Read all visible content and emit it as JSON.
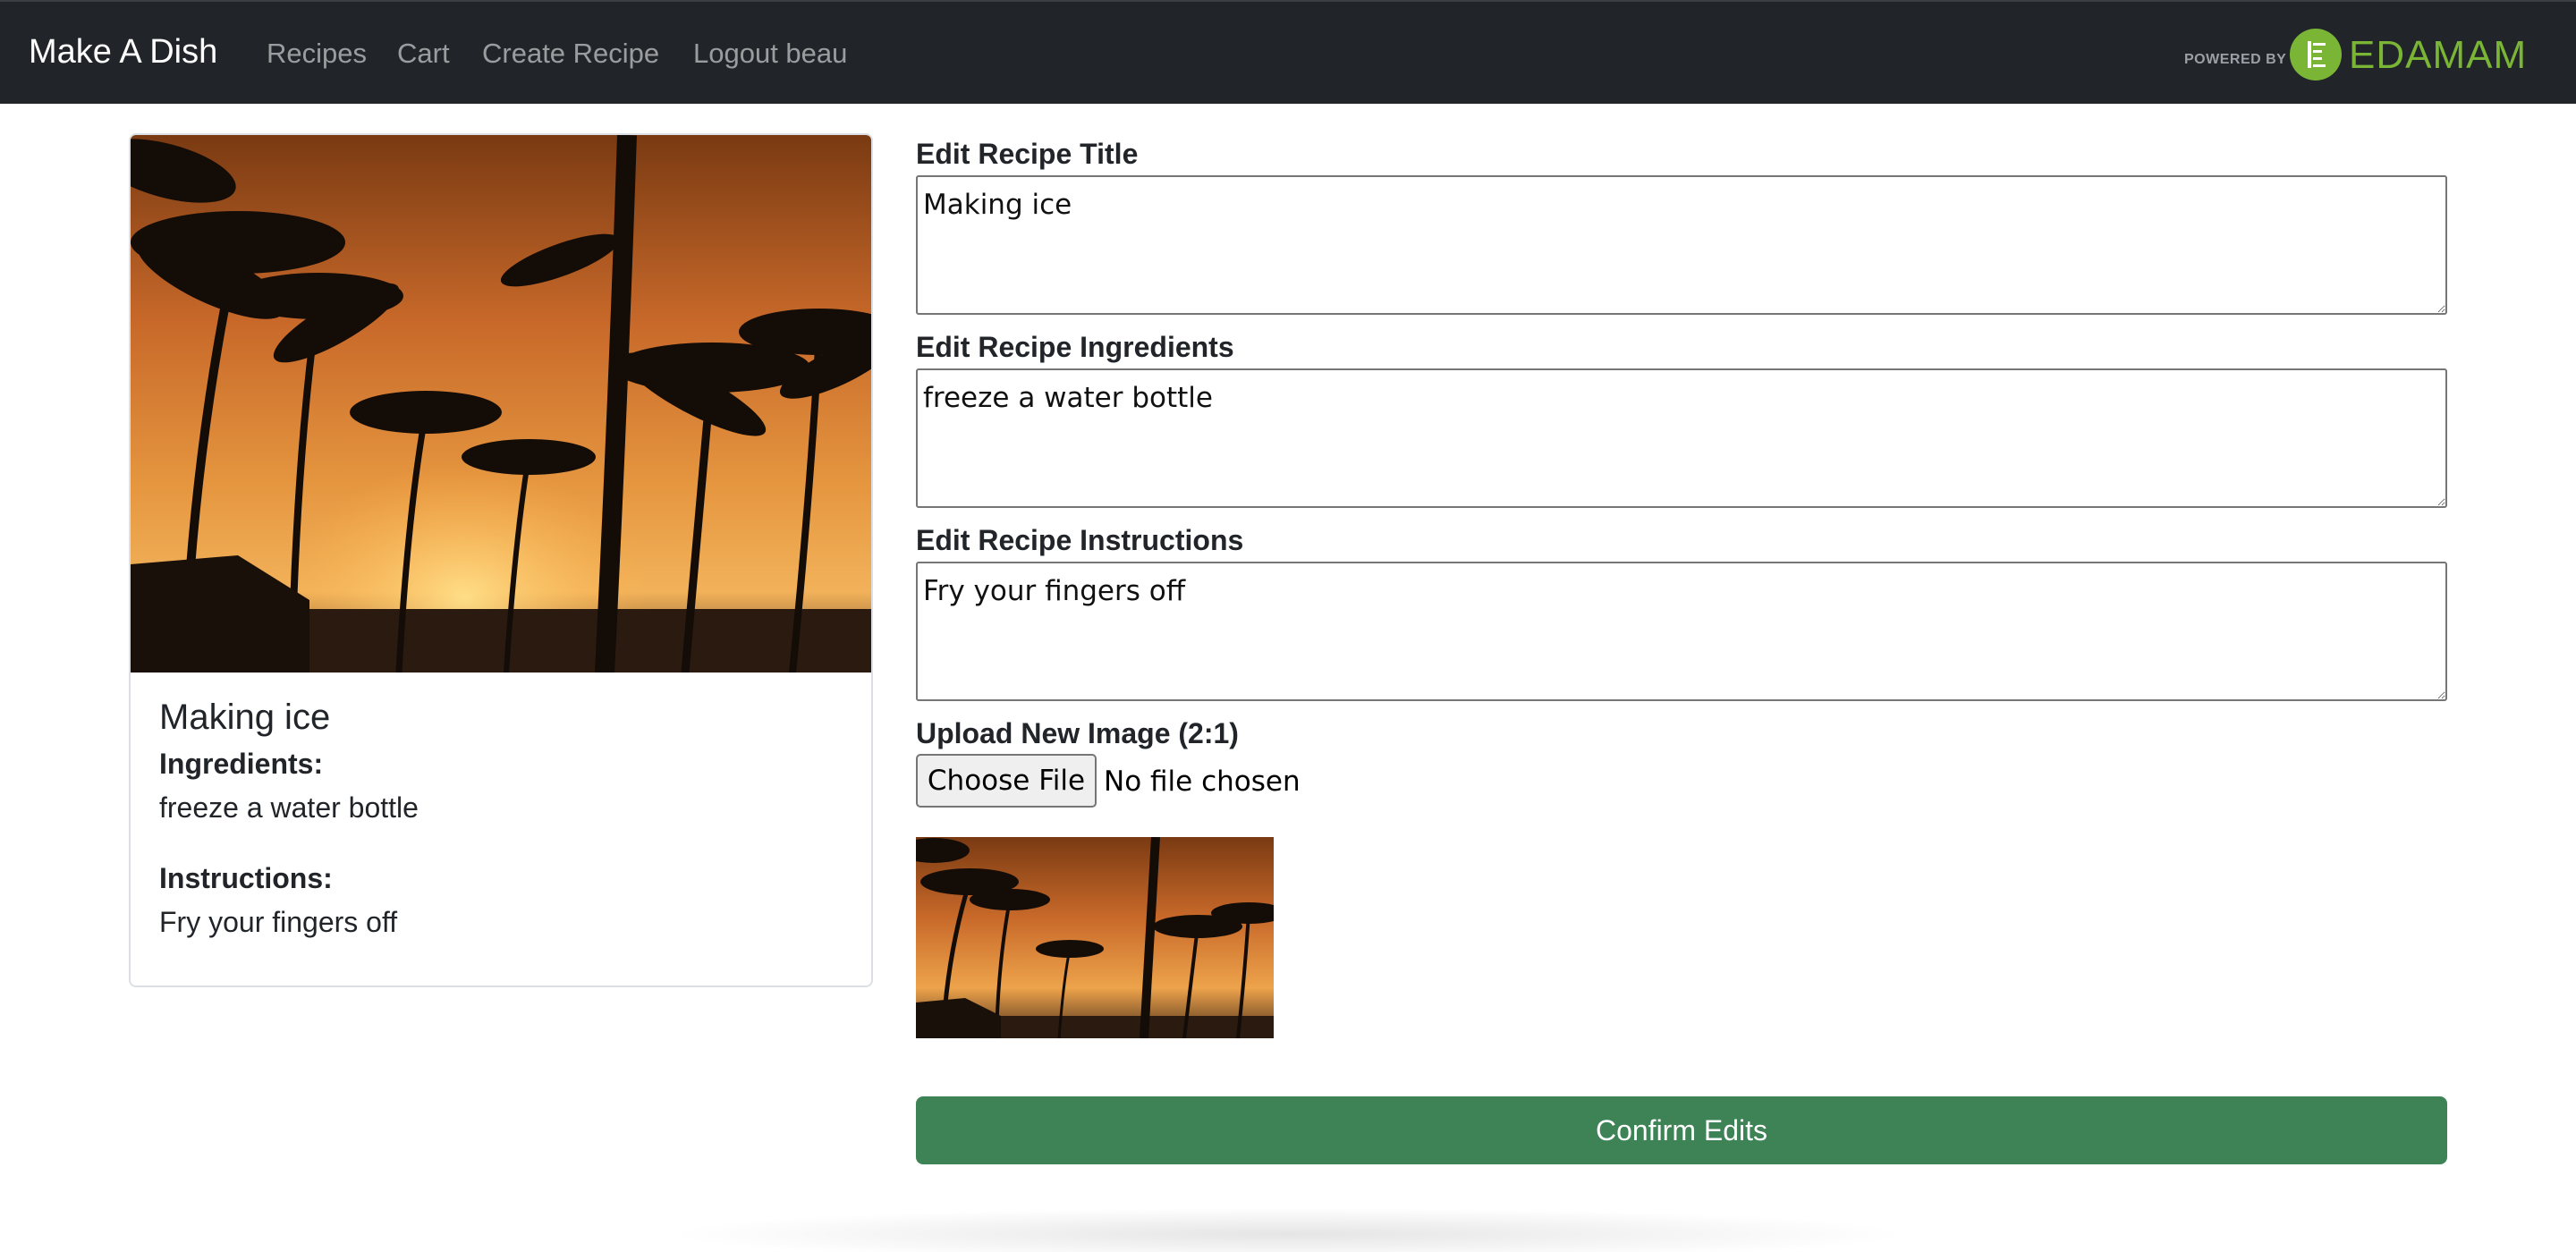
{
  "navbar": {
    "brand": "Make A Dish",
    "links": [
      "Recipes",
      "Cart",
      "Create Recipe",
      "Logout beau"
    ],
    "powered_by": "POWERED BY",
    "partner_logo_text": "EDAMAM",
    "partner_logo_icon": "edamam-logo-icon",
    "bg_color": "#212529",
    "partner_color": "#7ab536"
  },
  "card": {
    "image": "palm-trees-sunset-image",
    "title": "Making ice",
    "ingredients_label": "Ingredients:",
    "ingredients": "freeze a water bottle",
    "instructions_label": "Instructions:",
    "instructions": "Fry your fingers off"
  },
  "form": {
    "title_label": "Edit Recipe Title",
    "title_value": "Making ice",
    "ingredients_label": "Edit Recipe Ingredients",
    "ingredients_value": "freeze a water bottle",
    "instructions_label": "Edit Recipe Instructions",
    "instructions_value": "Fry your fingers off",
    "upload_label": "Upload New Image (2:1)",
    "choose_file": "Choose File",
    "file_status": "No file chosen",
    "preview_image": "palm-trees-sunset-thumbnail",
    "confirm_button": "Confirm Edits",
    "confirm_color": "#3e8355"
  }
}
